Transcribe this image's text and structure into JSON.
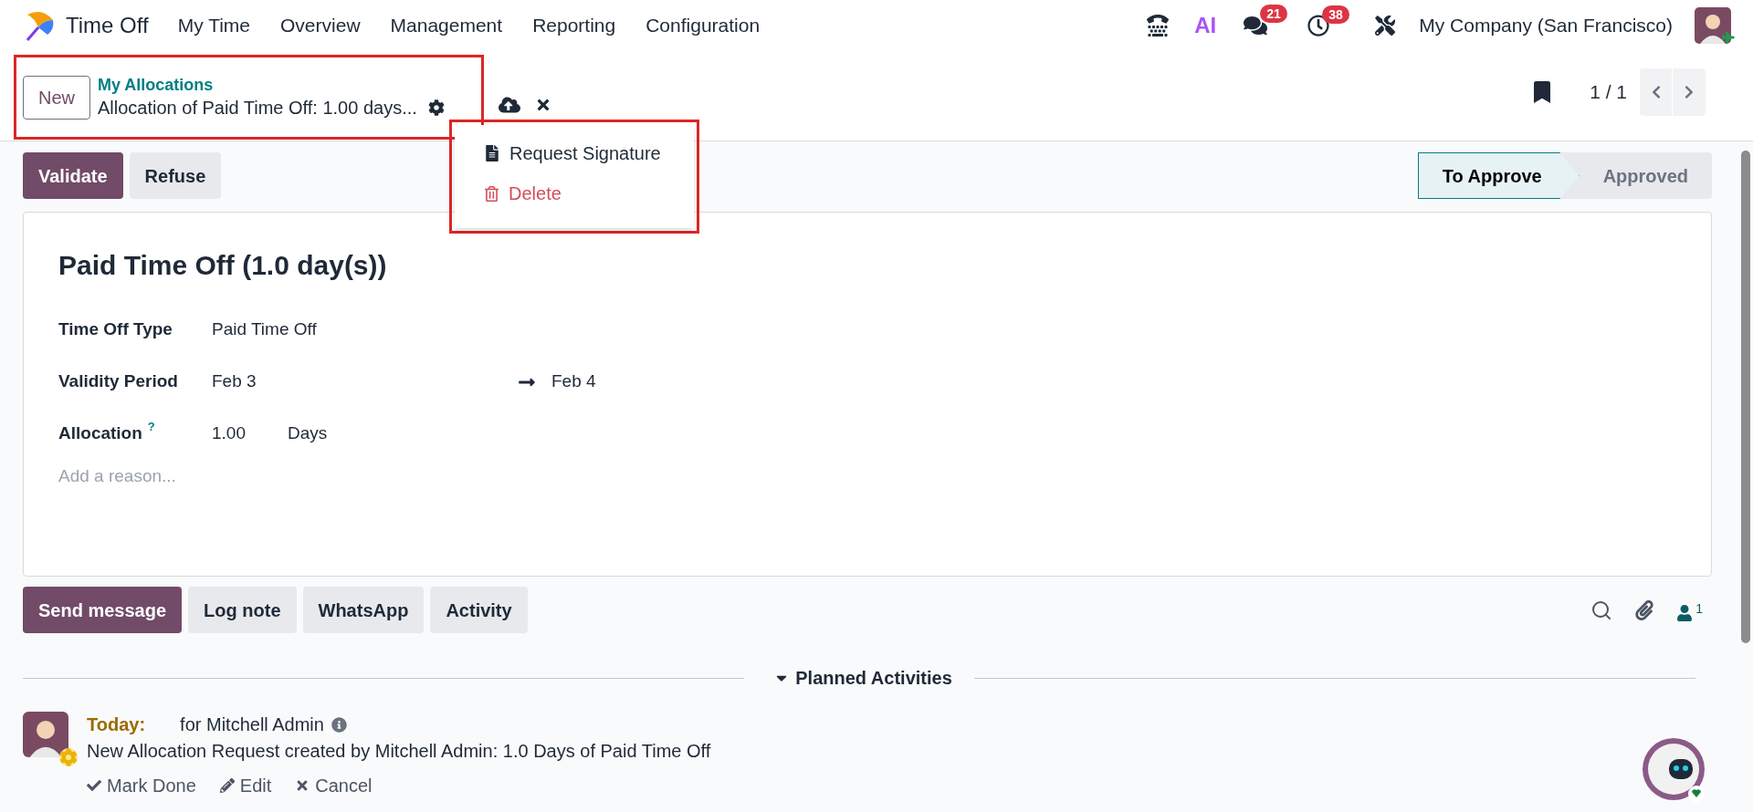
{
  "navbar": {
    "app_name": "Time Off",
    "menu": [
      "My Time",
      "Overview",
      "Management",
      "Reporting",
      "Configuration"
    ],
    "ai_label": "AI",
    "messages_badge": "21",
    "activities_badge": "38",
    "company": "My Company (San Francisco)"
  },
  "control_panel": {
    "new_button": "New",
    "breadcrumb": "My Allocations",
    "record_title": "Allocation of Paid Time Off: 1.00 days...",
    "pager": "1 / 1"
  },
  "action_menu": {
    "items": [
      {
        "label": "Request Signature",
        "kind": "document"
      },
      {
        "label": "Delete",
        "kind": "danger"
      }
    ]
  },
  "header_buttons": [
    {
      "label": "Validate",
      "kind": "primary"
    },
    {
      "label": "Refuse",
      "kind": "secondary"
    }
  ],
  "statusbar": [
    {
      "label": "To Approve",
      "selected": true
    },
    {
      "label": "Approved",
      "selected": false
    }
  ],
  "form": {
    "title": "Paid Time Off (1.0 day(s))",
    "fields": [
      {
        "kind": "text",
        "label": "Time Off Type",
        "value": "Paid Time Off"
      },
      {
        "kind": "daterange",
        "label": "Validity Period",
        "start": "Feb 3",
        "end": "Feb 4"
      },
      {
        "kind": "quantity",
        "label": "Allocation",
        "help": "?",
        "value": "1.00",
        "unit": "Days"
      }
    ],
    "reason_placeholder": "Add a reason..."
  },
  "chatter": {
    "buttons": [
      {
        "label": "Send message",
        "kind": "primary"
      },
      {
        "label": "Log note",
        "kind": "secondary"
      },
      {
        "label": "WhatsApp",
        "kind": "secondary"
      },
      {
        "label": "Activity",
        "kind": "secondary"
      }
    ],
    "followers_count": "1",
    "section_title": "Planned Activities",
    "activities": [
      {
        "due": "Today:",
        "assignee": "for Mitchell Admin",
        "summary": "New Allocation Request created by Mitchell Admin: 1.0 Days of Paid Time Off",
        "actions": [
          {
            "kind": "done",
            "label": "Mark Done"
          },
          {
            "kind": "edit",
            "label": "Edit"
          },
          {
            "kind": "cancel",
            "label": "Cancel"
          }
        ]
      }
    ]
  }
}
